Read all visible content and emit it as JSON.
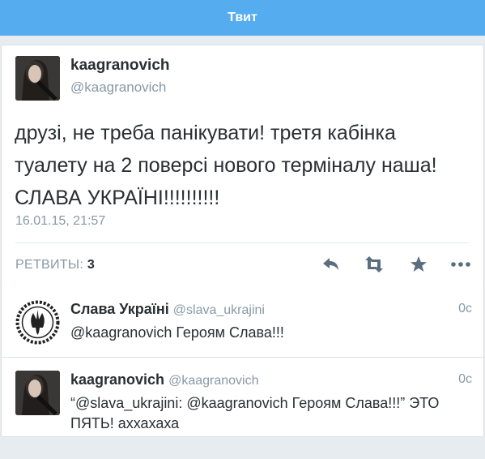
{
  "header": {
    "title": "Твит"
  },
  "tweet": {
    "author_name": "kaagranovich",
    "author_handle": "@kaagranovich",
    "text": "друзі, не треба панікувати! третя кабінка туалету на 2 поверсі нового терміналу наша! СЛАВА УКРАЇНІ!!!!!!!!!!",
    "timestamp": "16.01.15, 21:57",
    "retweets_label": "РЕТВИТЫ:",
    "retweets_count": "3"
  },
  "actions": [
    "reply-icon",
    "retweet-icon",
    "favorite-icon",
    "more-icon"
  ],
  "replies": [
    {
      "name": "Слава Україні",
      "handle": "@slava_ukrajini",
      "time": "0с",
      "text": "@kaagranovich Героям Слава!!!",
      "avatar": "trident-emblem"
    },
    {
      "name": "kaagranovich",
      "handle": "@kaagranovich",
      "time": "0с",
      "text": "“@slava_ukrajini: @kaagranovich Героям Слава!!!” ЭТО ПЯТЬ! аххахаха",
      "avatar": "user-photo"
    }
  ],
  "colors": {
    "accent": "#55acee",
    "muted": "#8899a6",
    "text": "#292f33",
    "background": "#e6ecf0"
  }
}
